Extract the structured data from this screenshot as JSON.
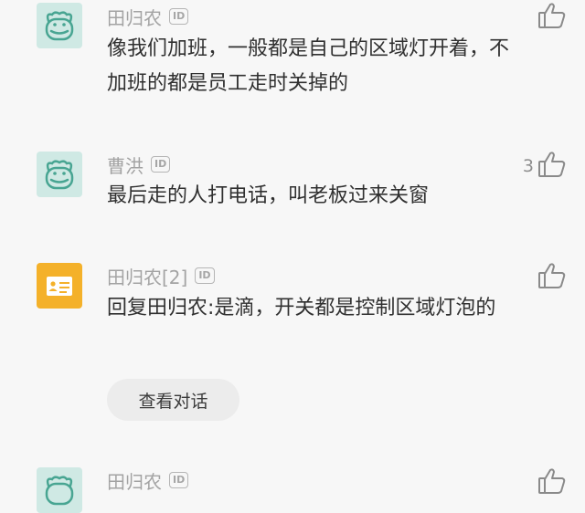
{
  "comments": [
    {
      "username": "田归农",
      "id_badge": "ID",
      "text": "像我们加班，一般都是自己的区域灯开着，不加班的都是员工走时关掉的",
      "likes": "",
      "avatar": "hippo"
    },
    {
      "username": "曹洪",
      "id_badge": "ID",
      "text": "最后走的人打电话，叫老板过来关窗",
      "likes": "3",
      "avatar": "hippo"
    },
    {
      "username": "田归农[2]",
      "id_badge": "ID",
      "text": "回复田归农:是滴，开关都是控制区域灯泡的",
      "likes": "",
      "avatar": "card",
      "view_conversation_label": "查看对话"
    },
    {
      "username": "田归农",
      "id_badge": "ID",
      "text": "",
      "likes": "",
      "avatar": "hippo"
    }
  ],
  "icons": {
    "like": "thumbs-up-icon",
    "avatar_hippo": "hippo-avatar-icon",
    "avatar_card": "id-card-avatar-icon"
  },
  "colors": {
    "background": "#f7f7f7",
    "username": "#a3a3a3",
    "text": "#303030",
    "hippo_avatar_bg": "#cfe9e4",
    "card_avatar_bg": "#f4b12a"
  }
}
